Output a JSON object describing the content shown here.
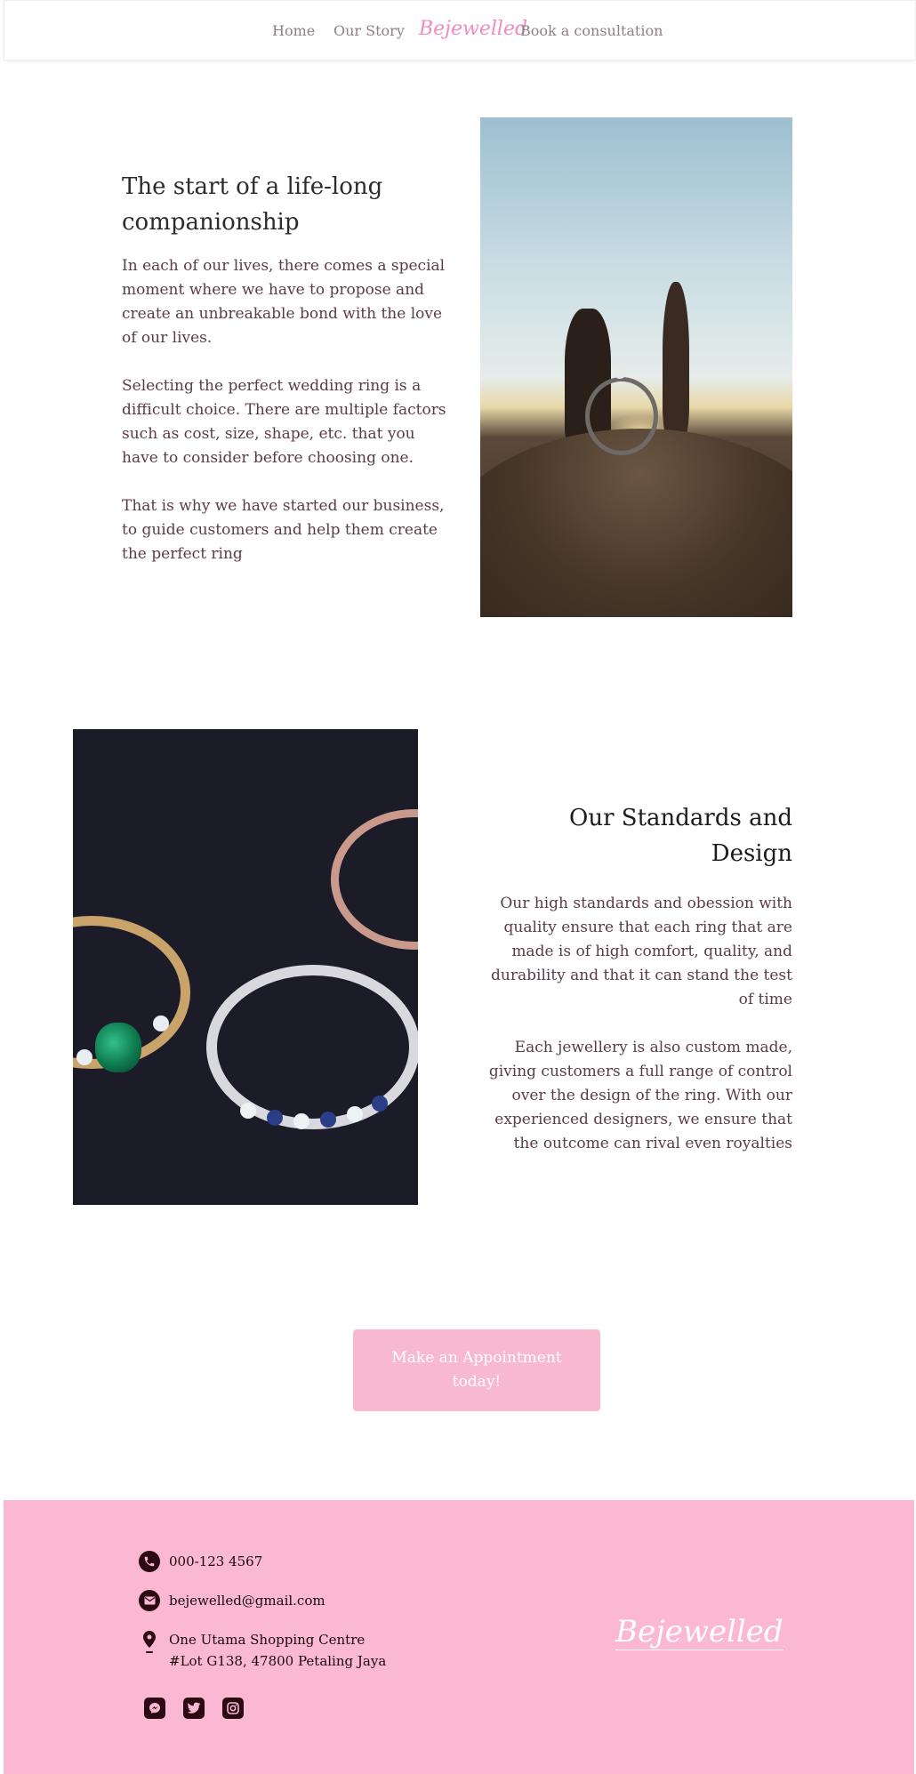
{
  "nav": {
    "home": "Home",
    "story": "Our Story",
    "brand": "Bejewelled",
    "consult": "Book a consultation"
  },
  "section1": {
    "heading": "The start of a life-long companionship",
    "paragraphs": [
      "In each of our lives, there comes a special moment where we have to propose and create an unbreakable bond with the love of our lives.",
      "Selecting the perfect wedding ring is a difficult choice. There are multiple factors such as cost, size, shape, etc. that you have to consider before choosing one.",
      "That is why we have started our business, to guide customers and help them create the perfect ring"
    ]
  },
  "section2": {
    "heading": "Our Standards and Design",
    "paragraphs": [
      "Our high standards and obession with quality ensure that each ring that are made is of high comfort, quality, and durability and that it can stand the test of time",
      "Each jewellery is also custom made, giving customers a full range of control over the design of the ring. With our experienced designers, we ensure that the outcome can rival even royalties"
    ]
  },
  "cta": {
    "label": "Make an Appointment today!"
  },
  "footer": {
    "phone": "000-123 4567",
    "email": "bejewelled@gmail.com",
    "address_line1": "One Utama Shopping Centre",
    "address_line2": "#Lot G138, 47800 Petaling Jaya",
    "brand": "Bejewelled",
    "social": [
      "messenger-icon",
      "twitter-icon",
      "instagram-icon"
    ]
  },
  "colors": {
    "brand_pink": "#f08cbf",
    "cta_pink": "#f8b8cf",
    "footer_pink": "#fbb8d3",
    "text_plum": "#5a3b4a",
    "icon_dark": "#2b0a14"
  }
}
